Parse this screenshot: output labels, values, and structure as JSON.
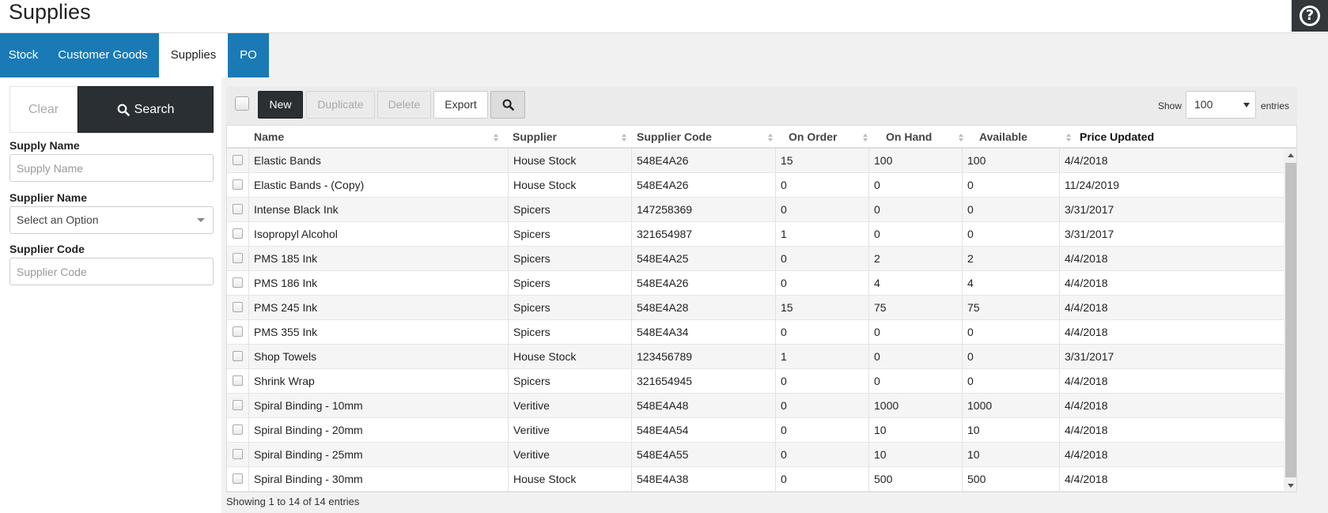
{
  "header": {
    "title": "Supplies",
    "help_symbol": "?"
  },
  "tabs": [
    {
      "label": "Stock"
    },
    {
      "label": "Customer Goods"
    },
    {
      "label": "Supplies",
      "active": true
    },
    {
      "label": "PO"
    }
  ],
  "filters": {
    "clear_label": "Clear",
    "search_label": "Search",
    "supply_name": {
      "label": "Supply Name",
      "placeholder": "Supply Name"
    },
    "supplier_name": {
      "label": "Supplier Name",
      "value": "Select an Option"
    },
    "supplier_code": {
      "label": "Supplier Code",
      "placeholder": "Supplier Code"
    }
  },
  "toolbar": {
    "new_label": "New",
    "duplicate_label": "Duplicate",
    "delete_label": "Delete",
    "export_label": "Export",
    "show_label": "Show",
    "show_value": "100",
    "entries_label": "entries"
  },
  "table": {
    "columns": [
      "Name",
      "Supplier",
      "Supplier Code",
      "On Order",
      "On Hand",
      "Available",
      "Price Updated"
    ],
    "rows": [
      [
        "Elastic Bands",
        "House Stock",
        "548E4A26",
        "15",
        "100",
        "100",
        "4/4/2018"
      ],
      [
        "Elastic Bands - (Copy)",
        "House Stock",
        "548E4A26",
        "0",
        "0",
        "0",
        "11/24/2019"
      ],
      [
        "Intense Black Ink",
        "Spicers",
        "147258369",
        "0",
        "0",
        "0",
        "3/31/2017"
      ],
      [
        "Isopropyl Alcohol",
        "Spicers",
        "321654987",
        "1",
        "0",
        "0",
        "3/31/2017"
      ],
      [
        "PMS 185 Ink",
        "Spicers",
        "548E4A25",
        "0",
        "2",
        "2",
        "4/4/2018"
      ],
      [
        "PMS 186 Ink",
        "Spicers",
        "548E4A26",
        "0",
        "4",
        "4",
        "4/4/2018"
      ],
      [
        "PMS 245 Ink",
        "Spicers",
        "548E4A28",
        "15",
        "75",
        "75",
        "4/4/2018"
      ],
      [
        "PMS 355 Ink",
        "Spicers",
        "548E4A34",
        "0",
        "0",
        "0",
        "4/4/2018"
      ],
      [
        "Shop Towels",
        "House Stock",
        "123456789",
        "1",
        "0",
        "0",
        "3/31/2017"
      ],
      [
        "Shrink Wrap",
        "Spicers",
        "321654945",
        "0",
        "0",
        "0",
        "4/4/2018"
      ],
      [
        "Spiral Binding - 10mm",
        "Veritive",
        "548E4A48",
        "0",
        "1000",
        "1000",
        "4/4/2018"
      ],
      [
        "Spiral Binding - 20mm",
        "Veritive",
        "548E4A54",
        "0",
        "10",
        "10",
        "4/4/2018"
      ],
      [
        "Spiral Binding - 25mm",
        "Veritive",
        "548E4A55",
        "0",
        "10",
        "10",
        "4/4/2018"
      ],
      [
        "Spiral Binding - 30mm",
        "House Stock",
        "548E4A38",
        "0",
        "500",
        "500",
        "4/4/2018"
      ]
    ],
    "footer": "Showing 1 to 14 of 14 entries"
  },
  "colors": {
    "tab_blue": "#1a7ab5",
    "dark_button": "#2a2f33"
  }
}
